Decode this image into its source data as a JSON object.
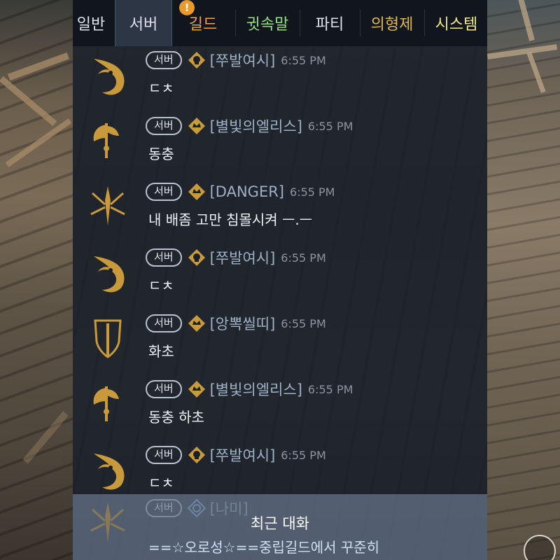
{
  "tabs": [
    {
      "label": "일반",
      "color": "#dde3ec"
    },
    {
      "label": "서버",
      "color": "#dde3ec",
      "active": true
    },
    {
      "label": "길드",
      "color": "#f0a43b",
      "alert": "!"
    },
    {
      "label": "귓속말",
      "color": "#8fe07a"
    },
    {
      "label": "파티",
      "color": "#dde3ec"
    },
    {
      "label": "의형제",
      "color": "#e2b64a"
    },
    {
      "label": "시스템",
      "color": "#f5e88a"
    }
  ],
  "messages": [
    {
      "channel": "서버",
      "sender": "[쭈발여시]",
      "time": "6:55 PM",
      "text": "ㄷㅊ",
      "emblem": "dragon-emblem-icon",
      "rank": "skull-rank-icon"
    },
    {
      "channel": "서버",
      "sender": "[별빛의엘리스]",
      "time": "6:55 PM",
      "text": "동충",
      "emblem": "axe-emblem-icon",
      "rank": "crown-rank-icon"
    },
    {
      "channel": "서버",
      "sender": "[DANGER]",
      "time": "6:55 PM",
      "text": "내 배좀 고만 침몰시켜 ㅡ.ㅡ",
      "emblem": "spear-emblem-icon",
      "rank": "crown-rank-icon"
    },
    {
      "channel": "서버",
      "sender": "[쭈발여시]",
      "time": "6:55 PM",
      "text": "ㄷㅊ",
      "emblem": "dragon-emblem-icon",
      "rank": "skull-rank-icon"
    },
    {
      "channel": "서버",
      "sender": "[앙뽁씰띠]",
      "time": "6:55 PM",
      "text": "화초",
      "emblem": "shield-emblem-icon",
      "rank": "crown-rank-icon"
    },
    {
      "channel": "서버",
      "sender": "[별빛의엘리스]",
      "time": "6:55 PM",
      "text": "동충 하초",
      "emblem": "axe-emblem-icon",
      "rank": "crown-rank-icon"
    },
    {
      "channel": "서버",
      "sender": "[쭈발여시]",
      "time": "6:55 PM",
      "text": "ㄷㅊ",
      "emblem": "dragon-emblem-icon",
      "rank": "skull-rank-icon"
    }
  ],
  "recent": {
    "title": "최근 대화",
    "channel": "서버",
    "sender": "[나미]",
    "text": "==☆오로성☆==중립길드에서 꾸준히",
    "emblem": "spear-emblem-icon",
    "rank": "crystal-rank-icon"
  },
  "colors": {
    "panel_bg": "#161c26",
    "tab_active_bg": "#2c3644",
    "emblem_gold": "#c99a3c",
    "sender_blue": "#9eb1c6",
    "recent_highlight": "#7e90aa"
  }
}
